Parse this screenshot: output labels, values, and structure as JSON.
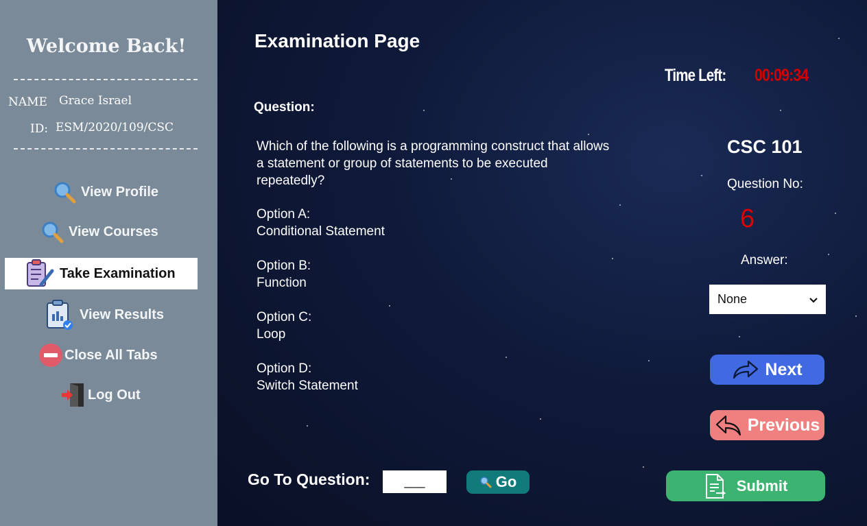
{
  "sidebar": {
    "welcome": "Welcome Back!",
    "name_label": "NAME",
    "name_value": "Grace Israel",
    "id_label": "ID:",
    "id_value": "ESM/2020/109/CSC",
    "items": [
      {
        "label": "View Profile",
        "icon": "magnifier-icon"
      },
      {
        "label": "View Courses",
        "icon": "magnifier-icon"
      },
      {
        "label": "Take Examination",
        "icon": "exam-clipboard-icon",
        "active": true
      },
      {
        "label": "View Results",
        "icon": "results-clipboard-icon"
      },
      {
        "label": "Close All Tabs",
        "icon": "minus-circle-icon"
      },
      {
        "label": "Log Out",
        "icon": "logout-door-icon"
      }
    ]
  },
  "main": {
    "title": "Examination Page",
    "timer_label": "Time Left:",
    "timer_value": "00:09:34",
    "question_label": "Question:",
    "question_text": "Which of the following is a programming construct that allows a statement or group of statements to be executed repeatedly?",
    "options": [
      {
        "label": "Option A:",
        "text": "Conditional Statement"
      },
      {
        "label": "Option B:",
        "text": "Function"
      },
      {
        "label": "Option C:",
        "text": "Loop"
      },
      {
        "label": "Option D:",
        "text": "Switch Statement"
      }
    ],
    "course": "CSC 101",
    "question_no_label": "Question No:",
    "question_no_value": "6",
    "answer_label": "Answer:",
    "answer_selected": "None",
    "next_label": "Next",
    "previous_label": "Previous",
    "submit_label": "Submit",
    "goto_label": "Go To Question:",
    "goto_value": "___",
    "go_label": "Go"
  },
  "colors": {
    "sidebar_bg": "#7a8a99",
    "timer": "#d00000",
    "next": "#4169e1",
    "previous": "#f08080",
    "submit": "#3cb371",
    "go": "#117a7a"
  }
}
